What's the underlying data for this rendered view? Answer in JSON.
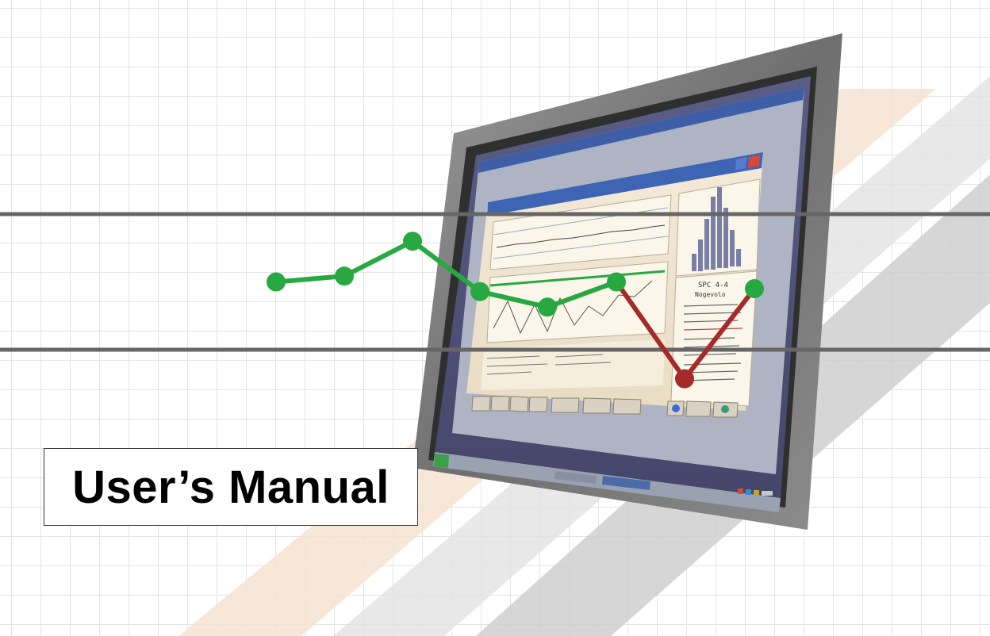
{
  "title": "User’s Manual",
  "colors": {
    "in_control_line": "#27a841",
    "out_of_control_line": "#a52a2a",
    "control_limit_lines": "#666666",
    "grid": "#e6e6e6",
    "monitor_bezel": "#7d7d7d",
    "orange_stripe": "#f6e6d6",
    "gray_stripe": "#d6d6d6"
  },
  "chart_data": {
    "type": "line",
    "series": [
      {
        "values": [
          0.3,
          0.36,
          0.72,
          0.2,
          0.04,
          0.3,
          -0.7,
          0.23
        ]
      }
    ],
    "control_limits": {
      "upper": 1.0,
      "lower": -0.4
    }
  },
  "screen": {
    "panel_title": "SPC 4-4",
    "panel_subtitle": "Nogevolo"
  }
}
